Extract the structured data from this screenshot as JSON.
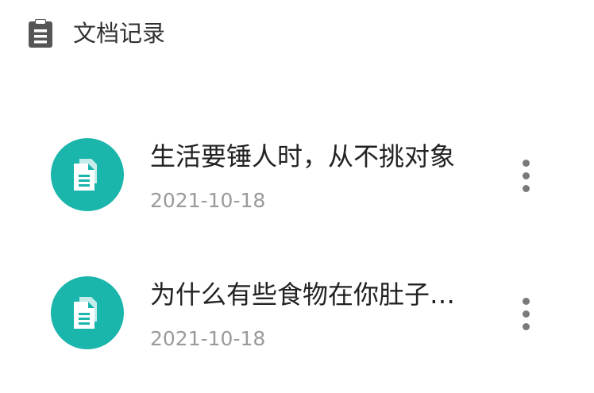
{
  "header": {
    "icon": "clipboard-icon",
    "title": "文档记录"
  },
  "documents": [
    {
      "icon": "document-icon",
      "title": "生活要锤人时，从不挑对象",
      "date": "2021-10-18",
      "menu_icon": "more-vertical-icon"
    },
    {
      "icon": "document-icon",
      "title": "为什么有些食物在你肚子…",
      "date": "2021-10-18",
      "menu_icon": "more-vertical-icon"
    }
  ],
  "colors": {
    "accent": "#1ab5ab",
    "title_text": "#222222",
    "date_text": "#9a9a9a",
    "header_text": "#333333",
    "menu_dots": "#7a7a7a"
  }
}
